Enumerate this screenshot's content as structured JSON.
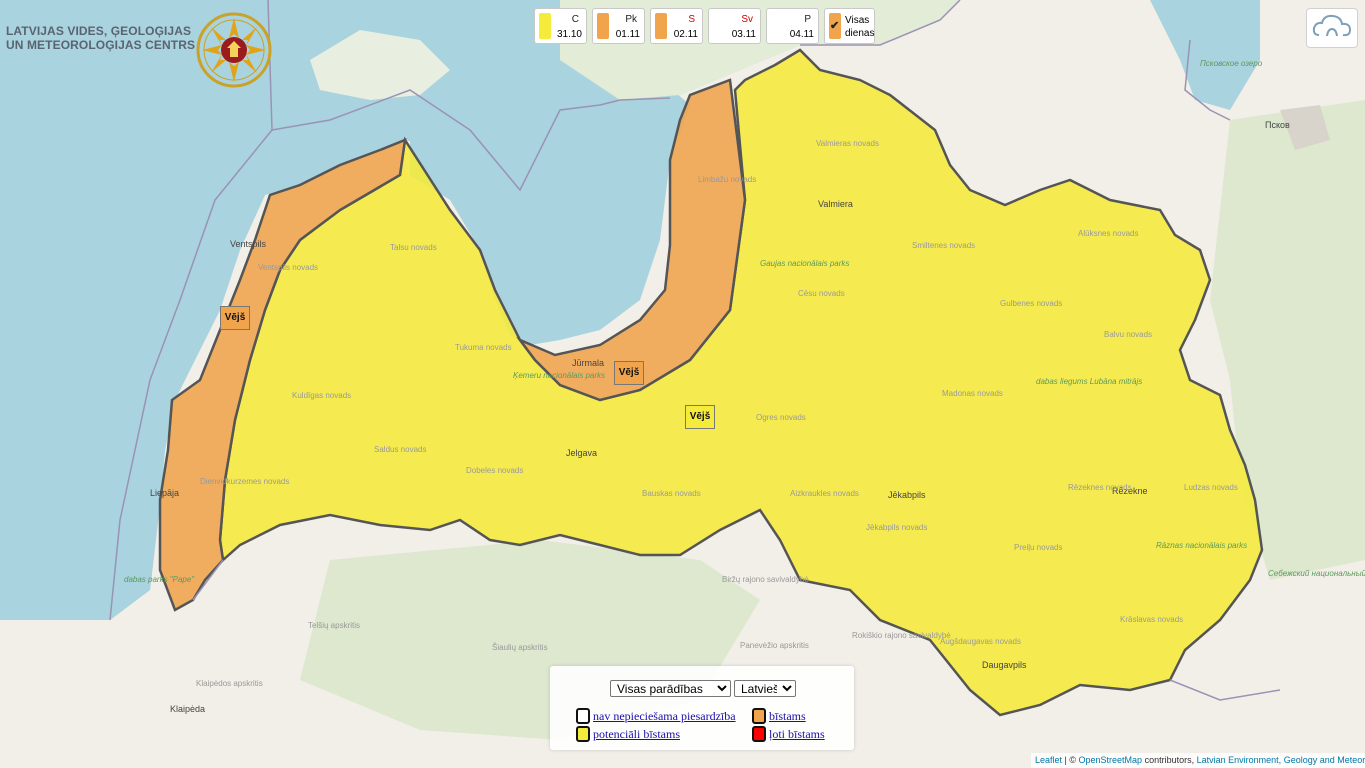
{
  "organization": {
    "line1": "LATVIJAS VIDES, ĢEOLOĢIJAS",
    "line2": "UN METEOROLOĢIJAS CENTRS"
  },
  "emblem_icon": "fire-rescue-emblem-icon",
  "colors": {
    "yellow": "#f5eb3b",
    "orange": "#f0a44b",
    "red": "#ff0000",
    "sea": "#a9d3df",
    "land": "#f2efe9"
  },
  "days": [
    {
      "name": "C",
      "date": "31.10",
      "color": "#f5eb3b",
      "name_color": "#222222"
    },
    {
      "name": "Pk",
      "date": "01.11",
      "color": "#f0a44b",
      "name_color": "#222222"
    },
    {
      "name": "S",
      "date": "02.11",
      "color": "#f0a44b",
      "name_color": "#d00000"
    },
    {
      "name": "Sv",
      "date": "03.11",
      "color": "#ffffff",
      "name_color": "#d00000"
    },
    {
      "name": "P",
      "date": "04.11",
      "color": "#ffffff",
      "name_color": "#222222"
    }
  ],
  "all_days": {
    "line1": "Visas",
    "line2": "dienas",
    "checked": true
  },
  "warnings": [
    {
      "label": "Vējš",
      "level": "orange"
    },
    {
      "label": "Vējš",
      "level": "orange"
    },
    {
      "label": "Vējš",
      "level": "yellow"
    }
  ],
  "legend": {
    "select_phenomena": "Visas parādības",
    "select_language": "Latviešu",
    "items": [
      {
        "label": "nav nepieciešama piesardzība",
        "color": "#ffffff"
      },
      {
        "label": "bīstams",
        "color": "#f0a44b"
      },
      {
        "label": "potenciāli bīstams",
        "color": "#f5eb3b"
      },
      {
        "label": "ļoti bīstams",
        "color": "#ff0000"
      }
    ]
  },
  "attribution": {
    "leaflet": "Leaflet",
    "osm": "OpenStreetMap",
    "contributors": "contributors,",
    "lvgmc": "Latvian Environment, Geology and Meteorology Centre"
  },
  "places": {
    "ventspils": "Ventspils",
    "liepaja": "Liepāja",
    "jurmala": "Jūrmala",
    "jelgava": "Jelgava",
    "valmiera": "Valmiera",
    "jekabpils": "Jēkabpils",
    "rezekne": "Rēzekne",
    "daugavpils": "Daugavpils",
    "pskov": "Псков",
    "klaipeda": "Klaipėda",
    "talsu": "Talsu novads",
    "ventspils_n": "Ventspils novads",
    "kuldigas": "Kuldīgas novads",
    "saldus": "Saldus novads",
    "dienvidkurzemes": "Dienvidkurzemes novads",
    "tukuma": "Tukuma novads",
    "dobeles": "Dobeles novads",
    "bauskas": "Bauskas novads",
    "ogres": "Ogres novads",
    "aizkraukles": "Aizkraukles novads",
    "jekabpils_n": "Jēkabpils novads",
    "madonas": "Madonas novads",
    "limbazu": "Limbažu novads",
    "valmieras": "Valmieras novads",
    "cesu": "Cēsu novads",
    "smiltenes": "Smiltenes novads",
    "gulbenes": "Gulbenes novads",
    "aluksnes": "Alūksnes novads",
    "balvu": "Balvu novads",
    "rezeknes_n": "Rēzeknes novads",
    "ludzas": "Ludzas novads",
    "preilu": "Preiļu novads",
    "kraslavas": "Krāslavas novads",
    "augsdaugavas": "Augšdaugavas novads",
    "telsiu": "Telšių apskritis",
    "siauliu": "Šiaulių apskritis",
    "klaipedos": "Klaipėdos apskritis",
    "panevezio": "Panevėžio apskritis",
    "birzu": "Biržų rajono savivaldybė",
    "rokiskio": "Rokiškio rajono savivaldybė",
    "pape": "dabas parks \"Pape\"",
    "gauja": "Gaujas nacionālais parks",
    "kemeri": "Ķemeru nacionālais parks",
    "lubana": "dabas liegums Lubāna mitrājs",
    "razna": "Rāznas nacionālais parks",
    "sebezh": "Себежский национальный парк",
    "pskovskoe": "Псковское озеро"
  }
}
